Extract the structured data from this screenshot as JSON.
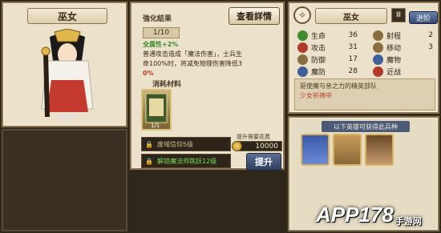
{
  "left": {
    "title": "巫女"
  },
  "enhance": {
    "section_label": "強化結果",
    "detail_button": "查看詳情",
    "level": "1/10",
    "line1": "全属性+2%",
    "line2": "普通攻击造成「魔法伤害」，士兵生",
    "line3": "命100%时，将减免物理伤害降低3",
    "line4": "0%",
    "materials_label": "消耗材料",
    "material_item_label": "1/1",
    "req1": "废域信仰5级",
    "req2": "解锁魔法师跳跃12级",
    "cost_label": "提升需要花费",
    "cost": "10000",
    "upgrade_button": "提升"
  },
  "hero": {
    "name": "巫女",
    "class_icon": "Ⅲ",
    "advance_button": "进阶",
    "stats": [
      {
        "label": "生命",
        "value": "36",
        "color": "#3f8b2d"
      },
      {
        "label": "攻击",
        "value": "31",
        "color": "#b13a2a"
      },
      {
        "label": "防御",
        "value": "17",
        "color": "#8a6e3f"
      },
      {
        "label": "魔防",
        "value": "28",
        "color": "#3f5f98"
      }
    ],
    "extras": [
      {
        "label": "射程",
        "value": "2",
        "color": "#8a6e3f"
      },
      {
        "label": "移动",
        "value": "3",
        "color": "#8a6e3f"
      },
      {
        "label": "魔物",
        "value": "",
        "color": "#3f5f98"
      },
      {
        "label": "近战",
        "value": "",
        "color": "#b13a2a"
      }
    ],
    "flavor_line1": "驱使魔与亲之力的精英部队",
    "flavor_line2": "少女祈祷中"
  },
  "heroes_panel": {
    "header": "以下英雄可获得此兵种"
  },
  "watermark": {
    "main": "APP178",
    "sub": "手游网"
  }
}
